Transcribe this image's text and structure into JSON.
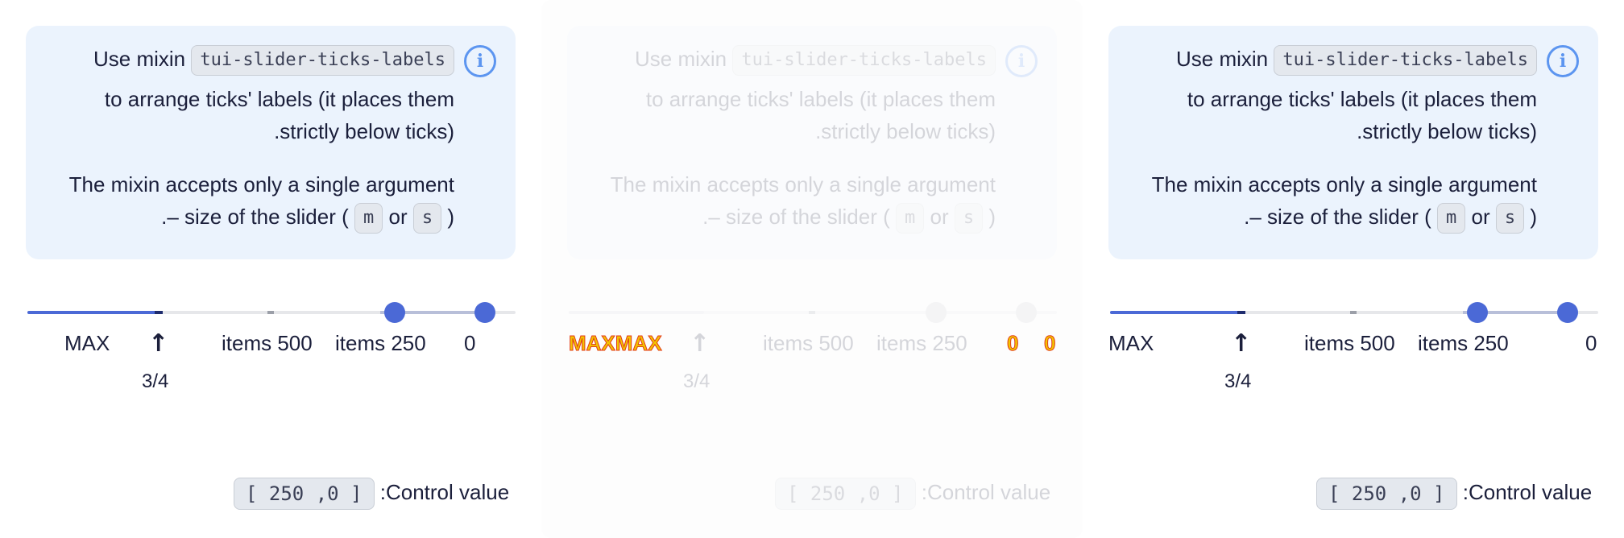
{
  "info": {
    "use_mixin": "Use mixin",
    "mixin_name": "tui-slider-ticks-labels",
    "arrange_line": "to arrange ticks' labels (it places them",
    "strictly_line": ".strictly below ticks)",
    "accepts_line": "The mixin accepts only a single argument",
    "size_prefix": ".– size of the slider (",
    "size_m": "m",
    "size_or": "or",
    "size_s": "s",
    "size_suffix": ")",
    "icon": "info-icon"
  },
  "slider": {
    "labels": {
      "max": "MAX",
      "items500": "items 500",
      "items250": "items 250",
      "zero": "0",
      "three_quarters": "3/4"
    },
    "values": [
      0,
      250
    ],
    "arrow_icon": "arrow-up-icon",
    "accent": "#4b69d6"
  },
  "control": {
    "label": ":Control value",
    "value": "[ 250 ,0 ]"
  },
  "overflow": {
    "max_max": "MAXMAX",
    "zero": "0"
  }
}
